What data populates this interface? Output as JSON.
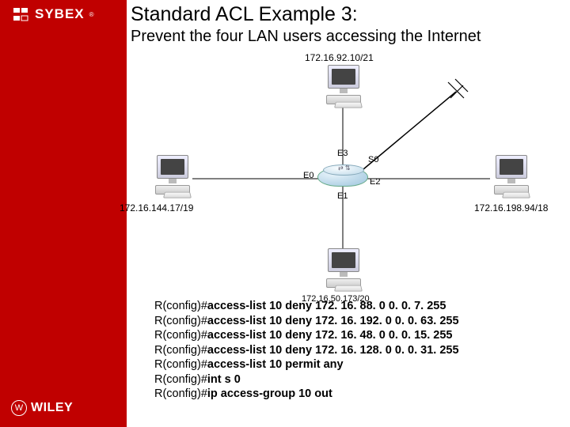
{
  "brand": {
    "sybex": "SYBEX",
    "wiley": "WILEY",
    "wiley_mark": "W"
  },
  "title": "Standard ACL Example 3:",
  "subtitle": "Prevent the four LAN users accessing the Internet",
  "diagram": {
    "top_ip": "172.16.92.10/21",
    "left_ip": "172.16.144.17/19",
    "right_ip": "172.16.198.94/18",
    "bottom_ip": "172.16.50.173/20",
    "ports": {
      "e0": "E0",
      "e1": "E1",
      "e2": "E2",
      "e3": "E3",
      "s0": "S0"
    }
  },
  "config": {
    "prefix": "R(config)#",
    "lines": [
      "access-list 10 deny 172. 16. 88. 0  0. 0. 7. 255",
      "access-list 10 deny 172. 16. 192. 0  0. 0. 63. 255",
      "access-list 10 deny 172. 16. 48. 0  0. 0. 15. 255",
      "access-list 10 deny 172. 16. 128. 0  0. 0. 31. 255",
      "access-list 10 permit any",
      "int s 0",
      "ip access-group 10 out"
    ]
  }
}
